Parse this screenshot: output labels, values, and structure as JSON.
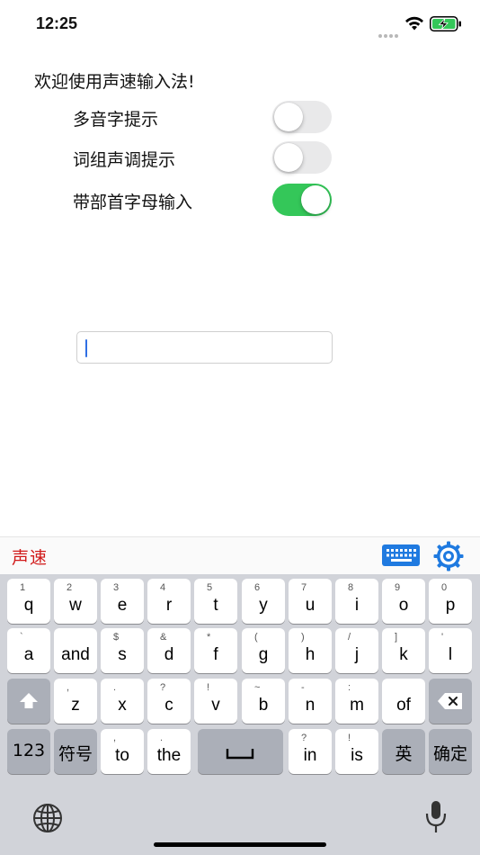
{
  "status_bar": {
    "time": "12:25"
  },
  "settings": {
    "welcome": "欢迎使用声速输入法!",
    "rows": [
      {
        "label": "多音字提示",
        "on": false
      },
      {
        "label": "词组声调提示",
        "on": false
      },
      {
        "label": "带部首字母输入",
        "on": true
      }
    ]
  },
  "input": {
    "value": ""
  },
  "keyboard": {
    "brand": "声速",
    "accent_color": "#d11a1a",
    "toggle_on_color": "#34c759",
    "row1": [
      {
        "alt": "1",
        "key": "q"
      },
      {
        "alt": "2",
        "key": "w"
      },
      {
        "alt": "3",
        "key": "e"
      },
      {
        "alt": "4",
        "key": "r"
      },
      {
        "alt": "5",
        "key": "t"
      },
      {
        "alt": "6",
        "key": "y"
      },
      {
        "alt": "7",
        "key": "u"
      },
      {
        "alt": "8",
        "key": "i"
      },
      {
        "alt": "9",
        "key": "o"
      },
      {
        "alt": "0",
        "key": "p"
      }
    ],
    "row2": [
      {
        "alt": "`",
        "key": "a"
      },
      {
        "alt": "",
        "key": "and"
      },
      {
        "alt": "$",
        "key": "s"
      },
      {
        "alt": "&",
        "key": "d"
      },
      {
        "alt": "*",
        "key": "f"
      },
      {
        "alt": "(",
        "key": "g"
      },
      {
        "alt": ")",
        "key": "h"
      },
      {
        "alt": "/",
        "key": "j"
      },
      {
        "alt": "]",
        "key": "k"
      },
      {
        "alt": "'",
        "key": "l"
      }
    ],
    "row3": [
      {
        "alt": ",",
        "key": "z"
      },
      {
        "alt": ".",
        "key": "x"
      },
      {
        "alt": "?",
        "key": "c"
      },
      {
        "alt": "!",
        "key": "v"
      },
      {
        "alt": "~",
        "key": "b"
      },
      {
        "alt": "-",
        "key": "n"
      },
      {
        "alt": ":",
        "key": "m"
      },
      {
        "alt": "",
        "key": "of"
      }
    ],
    "row4": {
      "numbers": "123",
      "symbols": "符号",
      "to": {
        "alt": ",",
        "key": "to"
      },
      "the": {
        "alt": ".",
        "key": "the"
      },
      "in": {
        "alt": "?",
        "key": "in"
      },
      "is": {
        "alt": "!",
        "key": "is"
      },
      "english": "英",
      "confirm": "确定"
    },
    "icons": {
      "keyboard": "keyboard-icon",
      "settings": "gear-icon",
      "shift": "shift-icon",
      "delete": "delete-icon",
      "space": "space-icon",
      "globe": "globe-icon",
      "mic": "microphone-icon"
    }
  }
}
